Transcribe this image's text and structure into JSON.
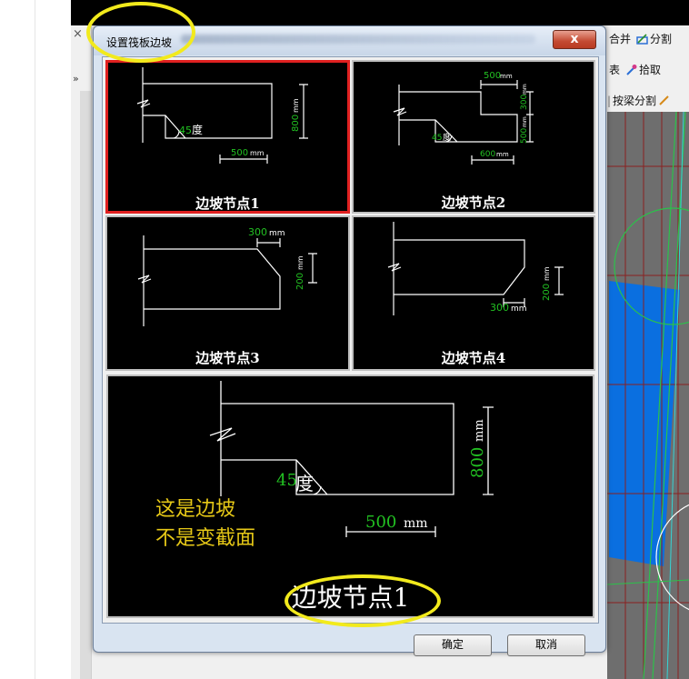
{
  "dialog": {
    "title": "设置筏板边坡",
    "close_glyph": "x",
    "ok_label": "确定",
    "cancel_label": "取消"
  },
  "background_app": {
    "close_glyph": "×",
    "expand_glyph": "»",
    "toolbar": {
      "merge_label": "合并",
      "split_label": "分割",
      "table_label": "表",
      "pick_label": "拾取",
      "beam_split_label": "按梁分割"
    }
  },
  "options": [
    {
      "caption": "边坡节点1",
      "angle": "45",
      "angle_unit": "度",
      "width": "500",
      "width_unit": "mm",
      "height": "800",
      "height_unit": "mm",
      "selected": true
    },
    {
      "caption": "边坡节点2",
      "angle": "45",
      "angle_unit": "度",
      "top_width": "500",
      "top_width_unit": "mm",
      "right_height": "300",
      "right_height_unit": "mm",
      "lower_height": "500",
      "lower_height_unit": "mm",
      "width": "600",
      "width_unit": "mm"
    },
    {
      "caption": "边坡节点3",
      "width": "300",
      "width_unit": "mm",
      "height": "200",
      "height_unit": "mm"
    },
    {
      "caption": "边坡节点4",
      "width": "300",
      "width_unit": "mm",
      "height": "200",
      "height_unit": "mm"
    }
  ],
  "preview": {
    "caption": "边坡节点1",
    "angle": "45",
    "angle_unit": "度",
    "width": "500",
    "width_unit": "mm",
    "height": "800",
    "height_unit": "mm",
    "note_line1": "这是边坡",
    "note_line2": "不是变截面"
  },
  "colors": {
    "drawing_line": "#ffffff",
    "dimension_text": "#22c122",
    "annotation_yellow": "#e6c817",
    "highlight_circle": "#f2ea1c",
    "selected_border": "#e02020",
    "canvas_blue": "#0a6fe0"
  }
}
